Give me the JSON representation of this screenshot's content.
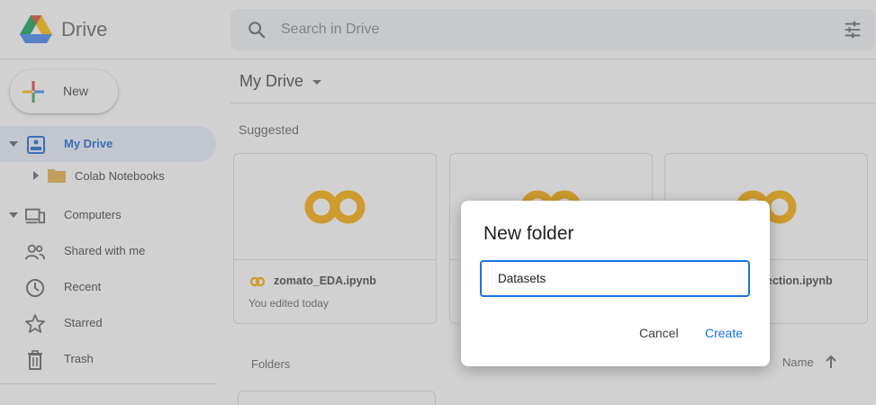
{
  "app": {
    "brand": "Drive"
  },
  "search": {
    "placeholder": "Search in Drive"
  },
  "sidebar": {
    "new_label": "New",
    "items": [
      {
        "label": "My Drive",
        "active": true
      },
      {
        "label": "Colab Notebooks"
      },
      {
        "label": "Computers"
      },
      {
        "label": "Shared with me"
      },
      {
        "label": "Recent"
      },
      {
        "label": "Starred"
      },
      {
        "label": "Trash"
      }
    ]
  },
  "main": {
    "title": "My Drive",
    "suggested_label": "Suggested",
    "folders_label": "Folders",
    "sort_label": "Name",
    "cards": [
      {
        "filename": "zomato_EDA.ipynb",
        "subtitle": "You edited today"
      },
      {
        "filename": "",
        "subtitle": ""
      },
      {
        "filename": "ection.ipynb",
        "subtitle": ""
      }
    ]
  },
  "dialog": {
    "title": "New folder",
    "input_value": "Datasets",
    "cancel_label": "Cancel",
    "create_label": "Create"
  },
  "colors": {
    "accent": "#1a73e8",
    "active_bg": "#e8f0fe",
    "colab_orange": "#f9ab00",
    "folder_gray": "#5f6368"
  }
}
